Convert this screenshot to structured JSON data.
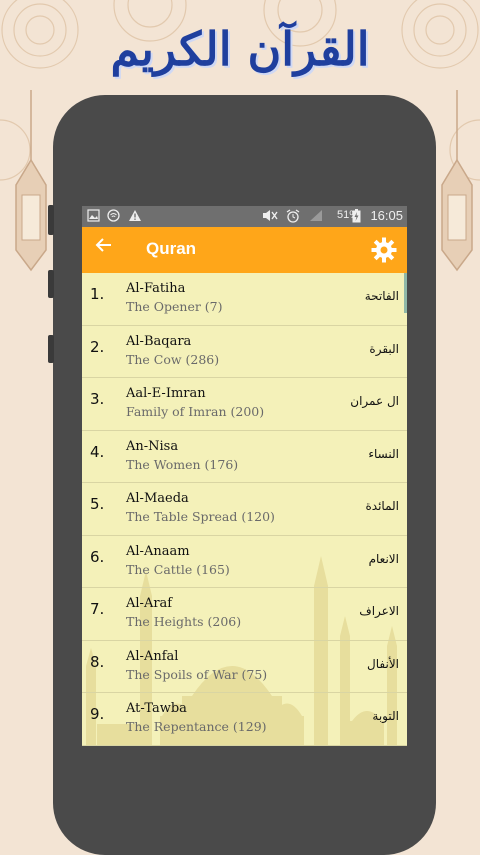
{
  "banner": {
    "title": "القرآن الكريم"
  },
  "status_bar": {
    "battery": "51%",
    "time": "16:05",
    "icons": [
      "image-icon",
      "wifi-icon",
      "warning-icon",
      "mute-icon",
      "alarm-icon",
      "signal-icon",
      "battery-charging-icon"
    ]
  },
  "app_bar": {
    "back_icon": "arrow-left-icon",
    "title": "Quran",
    "settings_icon": "gear-icon"
  },
  "surahs": [
    {
      "number": "1.",
      "name": "Al-Fatiha",
      "meaning": "The Opener (7)",
      "arabic": "الفاتحة"
    },
    {
      "number": "2.",
      "name": "Al-Baqara",
      "meaning": "The Cow (286)",
      "arabic": "البقرة"
    },
    {
      "number": "3.",
      "name": "Aal-E-Imran",
      "meaning": "Family of Imran (200)",
      "arabic": "ال عمران"
    },
    {
      "number": "4.",
      "name": "An-Nisa",
      "meaning": "The Women (176)",
      "arabic": "النساء"
    },
    {
      "number": "5.",
      "name": "Al-Maeda",
      "meaning": "The Table Spread (120)",
      "arabic": "المائدة"
    },
    {
      "number": "6.",
      "name": "Al-Anaam",
      "meaning": "The Cattle (165)",
      "arabic": "الانعام"
    },
    {
      "number": "7.",
      "name": "Al-Araf",
      "meaning": "The Heights (206)",
      "arabic": "الاعراف"
    },
    {
      "number": "8.",
      "name": "Al-Anfal",
      "meaning": "The Spoils of War (75)",
      "arabic": "الأنفال"
    },
    {
      "number": "9.",
      "name": "At-Tawba",
      "meaning": "The Repentance (129)",
      "arabic": "التوبة"
    }
  ],
  "colors": {
    "background": "#f3e4d4",
    "app_bar": "#ffa619",
    "list_background": "#f4f1b9",
    "phone_frame": "#4a4a4a",
    "title_blue": "#1f3f9e"
  }
}
